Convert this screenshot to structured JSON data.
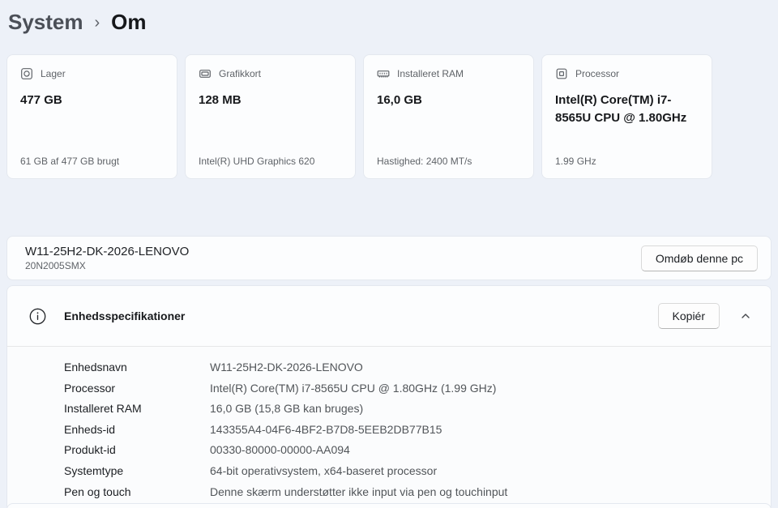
{
  "breadcrumb": {
    "root": "System",
    "separator": "›",
    "current": "Om"
  },
  "cards": [
    {
      "icon": "storage-icon",
      "label": "Lager",
      "value": "477 GB",
      "caption": "61 GB af 477 GB brugt"
    },
    {
      "icon": "gpu-icon",
      "label": "Grafikkort",
      "value": "128 MB",
      "caption": "Intel(R) UHD Graphics 620"
    },
    {
      "icon": "ram-icon",
      "label": "Installeret RAM",
      "value": "16,0 GB",
      "caption": "Hastighed: 2400 MT/s"
    },
    {
      "icon": "cpu-icon",
      "label": "Processor",
      "value": "Intel(R) Core(TM) i7-8565U CPU @ 1.80GHz",
      "caption": "1.99 GHz"
    }
  ],
  "device": {
    "name": "W11-25H2-DK-2026-LENOVO",
    "model": "20N2005SMX",
    "rename_button": "Omdøb denne pc"
  },
  "spec": {
    "title": "Enhedsspecifikationer",
    "copy_button": "Kopiér",
    "rows": [
      {
        "label": "Enhedsnavn",
        "value": "W11-25H2-DK-2026-LENOVO"
      },
      {
        "label": "Processor",
        "value": "Intel(R) Core(TM) i7-8565U CPU @ 1.80GHz (1.99 GHz)"
      },
      {
        "label": "Installeret RAM",
        "value": "16,0 GB (15,8 GB kan bruges)"
      },
      {
        "label": "Enheds-id",
        "value": "143355A4-04F6-4BF2-B7D8-5EEB2DB77B15"
      },
      {
        "label": "Produkt-id",
        "value": "00330-80000-00000-AA094"
      },
      {
        "label": "Systemtype",
        "value": "64-bit operativsystem, x64-baseret processor"
      },
      {
        "label": "Pen og touch",
        "value": "Denne skærm understøtter ikke input via pen og touchinput"
      }
    ]
  },
  "colors": {
    "page_background": "#edf1f8",
    "card_background": "#fcfdfe",
    "card_border": "#e4e8ef",
    "text_primary": "#17191c",
    "text_secondary": "#5f6368"
  }
}
